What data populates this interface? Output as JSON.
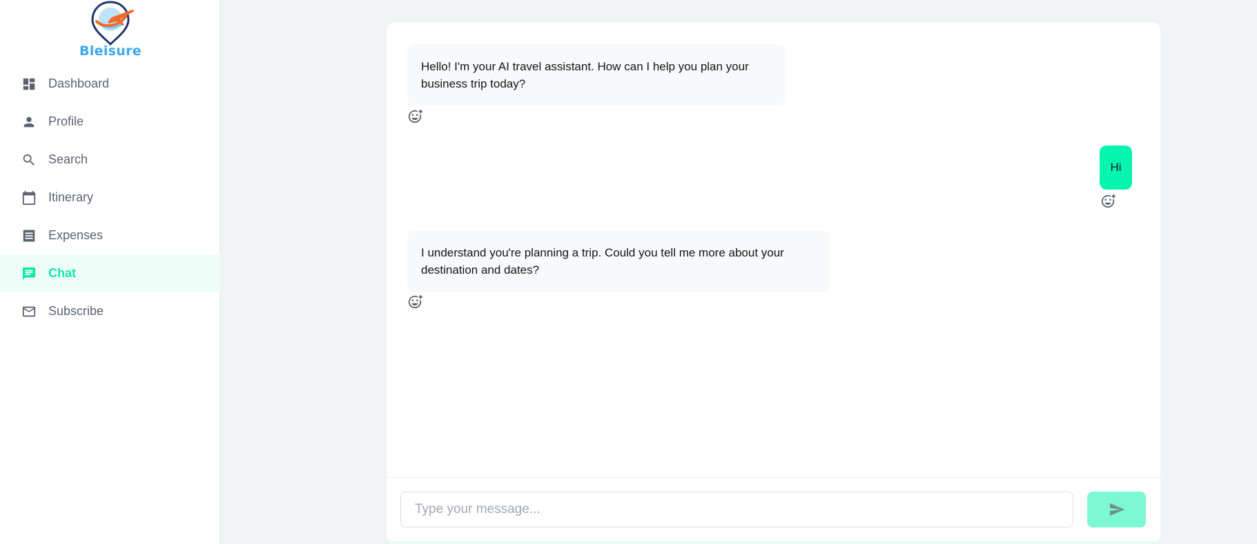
{
  "brand": {
    "name": "Bleisure",
    "logo_icon": "map-pin-airplane-logo"
  },
  "sidebar": {
    "items": [
      {
        "label": "Dashboard",
        "icon": "dashboard-icon",
        "active": false
      },
      {
        "label": "Profile",
        "icon": "person-icon",
        "active": false
      },
      {
        "label": "Search",
        "icon": "search-icon",
        "active": false
      },
      {
        "label": "Itinerary",
        "icon": "calendar-icon",
        "active": false
      },
      {
        "label": "Expenses",
        "icon": "receipt-icon",
        "active": false
      },
      {
        "label": "Chat",
        "icon": "chat-icon",
        "active": true
      },
      {
        "label": "Subscribe",
        "icon": "mail-icon",
        "active": false
      }
    ]
  },
  "chat": {
    "messages": [
      {
        "sender": "bot",
        "text": "Hello! I'm your AI travel assistant. How can I help you plan your business trip today?",
        "reaction_icon": "add-reaction-icon"
      },
      {
        "sender": "user",
        "text": "Hi",
        "reaction_icon": "add-reaction-icon"
      },
      {
        "sender": "bot",
        "text": "I understand you're planning a trip. Could you tell me more about your destination and dates?",
        "reaction_icon": "add-reaction-icon"
      }
    ],
    "input": {
      "value": "",
      "placeholder": "Type your message..."
    },
    "send_icon": "send-icon"
  },
  "colors": {
    "accent": "#14e8a8",
    "user_bubble": "#07f5b1",
    "send_button": "#7cf8d3",
    "active_nav_bg": "#effdf8",
    "page_bg": "#f1f4f4",
    "brand_text": "#3aa7f0"
  }
}
